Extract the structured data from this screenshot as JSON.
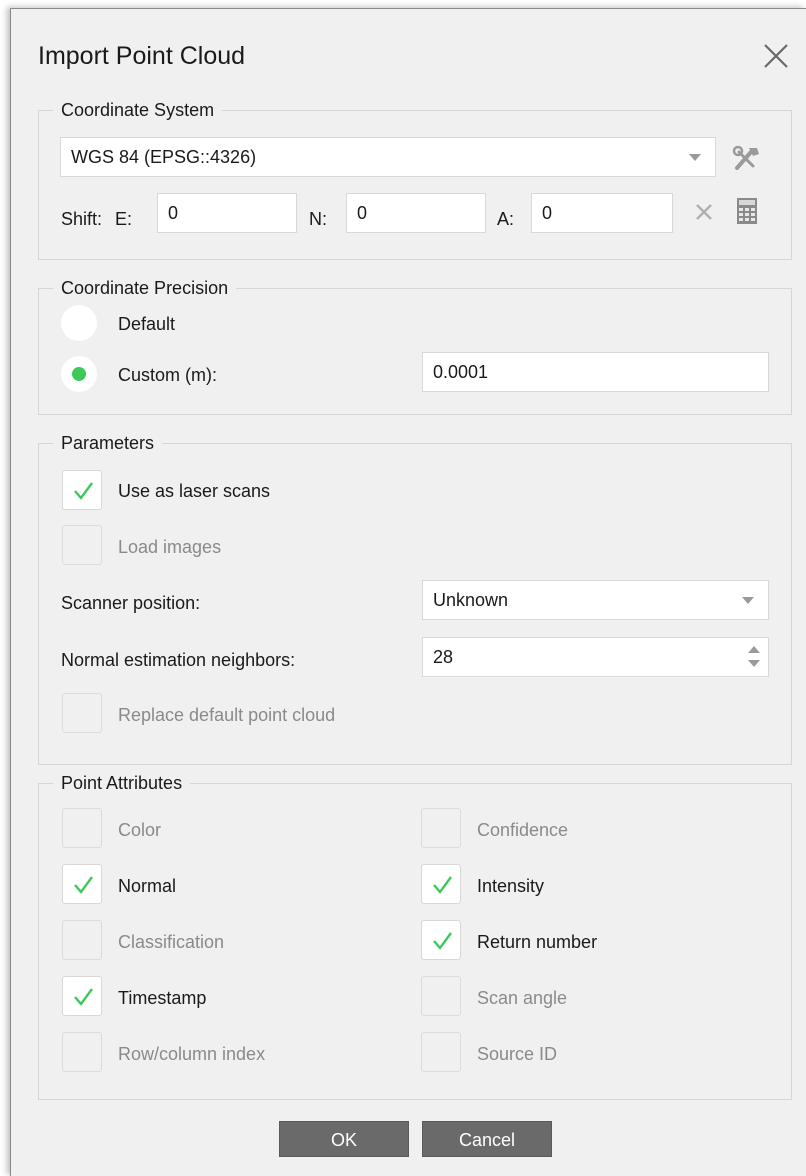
{
  "dialog": {
    "title": "Import Point Cloud"
  },
  "coordinate_system": {
    "legend": "Coordinate System",
    "selected": "WGS 84 (EPSG::4326)",
    "shift_label": "Shift:",
    "e_label": "E:",
    "e_value": "0",
    "n_label": "N:",
    "n_value": "0",
    "a_label": "A:",
    "a_value": "0"
  },
  "precision": {
    "legend": "Coordinate Precision",
    "default_label": "Default",
    "custom_label": "Custom (m):",
    "custom_value": "0.0001",
    "selected": "custom"
  },
  "parameters": {
    "legend": "Parameters",
    "use_as_laser_scans": {
      "label": "Use as laser scans",
      "checked": true,
      "enabled": true
    },
    "load_images": {
      "label": "Load images",
      "checked": false,
      "enabled": false
    },
    "scanner_position_label": "Scanner position:",
    "scanner_position_value": "Unknown",
    "normal_neighbors_label": "Normal estimation neighbors:",
    "normal_neighbors_value": "28",
    "replace_default": {
      "label": "Replace default point cloud",
      "checked": false,
      "enabled": false
    }
  },
  "point_attributes": {
    "legend": "Point Attributes",
    "left": [
      {
        "label": "Color",
        "checked": false,
        "enabled": false
      },
      {
        "label": "Normal",
        "checked": true,
        "enabled": true
      },
      {
        "label": "Classification",
        "checked": false,
        "enabled": false
      },
      {
        "label": "Timestamp",
        "checked": true,
        "enabled": true
      },
      {
        "label": "Row/column index",
        "checked": false,
        "enabled": false
      }
    ],
    "right": [
      {
        "label": "Confidence",
        "checked": false,
        "enabled": false
      },
      {
        "label": "Intensity",
        "checked": true,
        "enabled": true
      },
      {
        "label": "Return number",
        "checked": true,
        "enabled": true
      },
      {
        "label": "Scan angle",
        "checked": false,
        "enabled": false
      },
      {
        "label": "Source ID",
        "checked": false,
        "enabled": false
      }
    ]
  },
  "buttons": {
    "ok": "OK",
    "cancel": "Cancel"
  },
  "colors": {
    "check": "#3cc95a",
    "button": "#6a6a6a",
    "dialog_bg": "#f0f0f0"
  }
}
